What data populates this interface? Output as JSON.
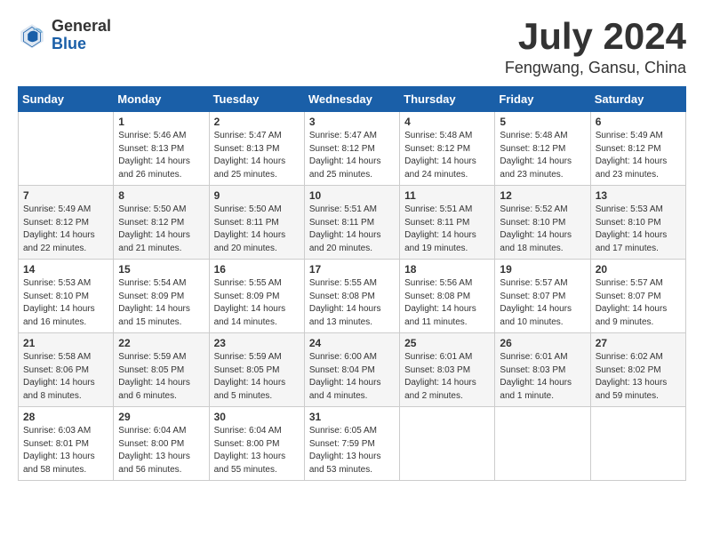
{
  "header": {
    "logo_general": "General",
    "logo_blue": "Blue",
    "month_title": "July 2024",
    "location": "Fengwang, Gansu, China"
  },
  "columns": [
    "Sunday",
    "Monday",
    "Tuesday",
    "Wednesday",
    "Thursday",
    "Friday",
    "Saturday"
  ],
  "weeks": [
    [
      {
        "day": "",
        "info": ""
      },
      {
        "day": "1",
        "info": "Sunrise: 5:46 AM\nSunset: 8:13 PM\nDaylight: 14 hours\nand 26 minutes."
      },
      {
        "day": "2",
        "info": "Sunrise: 5:47 AM\nSunset: 8:13 PM\nDaylight: 14 hours\nand 25 minutes."
      },
      {
        "day": "3",
        "info": "Sunrise: 5:47 AM\nSunset: 8:12 PM\nDaylight: 14 hours\nand 25 minutes."
      },
      {
        "day": "4",
        "info": "Sunrise: 5:48 AM\nSunset: 8:12 PM\nDaylight: 14 hours\nand 24 minutes."
      },
      {
        "day": "5",
        "info": "Sunrise: 5:48 AM\nSunset: 8:12 PM\nDaylight: 14 hours\nand 23 minutes."
      },
      {
        "day": "6",
        "info": "Sunrise: 5:49 AM\nSunset: 8:12 PM\nDaylight: 14 hours\nand 23 minutes."
      }
    ],
    [
      {
        "day": "7",
        "info": "Sunrise: 5:49 AM\nSunset: 8:12 PM\nDaylight: 14 hours\nand 22 minutes."
      },
      {
        "day": "8",
        "info": "Sunrise: 5:50 AM\nSunset: 8:12 PM\nDaylight: 14 hours\nand 21 minutes."
      },
      {
        "day": "9",
        "info": "Sunrise: 5:50 AM\nSunset: 8:11 PM\nDaylight: 14 hours\nand 20 minutes."
      },
      {
        "day": "10",
        "info": "Sunrise: 5:51 AM\nSunset: 8:11 PM\nDaylight: 14 hours\nand 20 minutes."
      },
      {
        "day": "11",
        "info": "Sunrise: 5:51 AM\nSunset: 8:11 PM\nDaylight: 14 hours\nand 19 minutes."
      },
      {
        "day": "12",
        "info": "Sunrise: 5:52 AM\nSunset: 8:10 PM\nDaylight: 14 hours\nand 18 minutes."
      },
      {
        "day": "13",
        "info": "Sunrise: 5:53 AM\nSunset: 8:10 PM\nDaylight: 14 hours\nand 17 minutes."
      }
    ],
    [
      {
        "day": "14",
        "info": "Sunrise: 5:53 AM\nSunset: 8:10 PM\nDaylight: 14 hours\nand 16 minutes."
      },
      {
        "day": "15",
        "info": "Sunrise: 5:54 AM\nSunset: 8:09 PM\nDaylight: 14 hours\nand 15 minutes."
      },
      {
        "day": "16",
        "info": "Sunrise: 5:55 AM\nSunset: 8:09 PM\nDaylight: 14 hours\nand 14 minutes."
      },
      {
        "day": "17",
        "info": "Sunrise: 5:55 AM\nSunset: 8:08 PM\nDaylight: 14 hours\nand 13 minutes."
      },
      {
        "day": "18",
        "info": "Sunrise: 5:56 AM\nSunset: 8:08 PM\nDaylight: 14 hours\nand 11 minutes."
      },
      {
        "day": "19",
        "info": "Sunrise: 5:57 AM\nSunset: 8:07 PM\nDaylight: 14 hours\nand 10 minutes."
      },
      {
        "day": "20",
        "info": "Sunrise: 5:57 AM\nSunset: 8:07 PM\nDaylight: 14 hours\nand 9 minutes."
      }
    ],
    [
      {
        "day": "21",
        "info": "Sunrise: 5:58 AM\nSunset: 8:06 PM\nDaylight: 14 hours\nand 8 minutes."
      },
      {
        "day": "22",
        "info": "Sunrise: 5:59 AM\nSunset: 8:05 PM\nDaylight: 14 hours\nand 6 minutes."
      },
      {
        "day": "23",
        "info": "Sunrise: 5:59 AM\nSunset: 8:05 PM\nDaylight: 14 hours\nand 5 minutes."
      },
      {
        "day": "24",
        "info": "Sunrise: 6:00 AM\nSunset: 8:04 PM\nDaylight: 14 hours\nand 4 minutes."
      },
      {
        "day": "25",
        "info": "Sunrise: 6:01 AM\nSunset: 8:03 PM\nDaylight: 14 hours\nand 2 minutes."
      },
      {
        "day": "26",
        "info": "Sunrise: 6:01 AM\nSunset: 8:03 PM\nDaylight: 14 hours\nand 1 minute."
      },
      {
        "day": "27",
        "info": "Sunrise: 6:02 AM\nSunset: 8:02 PM\nDaylight: 13 hours\nand 59 minutes."
      }
    ],
    [
      {
        "day": "28",
        "info": "Sunrise: 6:03 AM\nSunset: 8:01 PM\nDaylight: 13 hours\nand 58 minutes."
      },
      {
        "day": "29",
        "info": "Sunrise: 6:04 AM\nSunset: 8:00 PM\nDaylight: 13 hours\nand 56 minutes."
      },
      {
        "day": "30",
        "info": "Sunrise: 6:04 AM\nSunset: 8:00 PM\nDaylight: 13 hours\nand 55 minutes."
      },
      {
        "day": "31",
        "info": "Sunrise: 6:05 AM\nSunset: 7:59 PM\nDaylight: 13 hours\nand 53 minutes."
      },
      {
        "day": "",
        "info": ""
      },
      {
        "day": "",
        "info": ""
      },
      {
        "day": "",
        "info": ""
      }
    ]
  ]
}
